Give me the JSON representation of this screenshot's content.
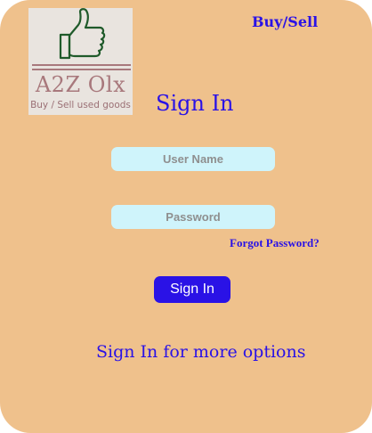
{
  "logo": {
    "title": "A2Z Olx",
    "tagline": "Buy / Sell used goods",
    "icon": "thumbs-up-icon"
  },
  "nav": {
    "buy_sell": "Buy/Sell"
  },
  "form": {
    "heading": "Sign In",
    "username_placeholder": "User Name",
    "password_placeholder": "Password",
    "forgot_password": "Forgot Password?",
    "submit_label": "Sign In",
    "more_options": "Sign In for more options"
  },
  "colors": {
    "background": "#efc18c",
    "accent": "#2a12e6",
    "input_fill": "#cff4fb"
  }
}
